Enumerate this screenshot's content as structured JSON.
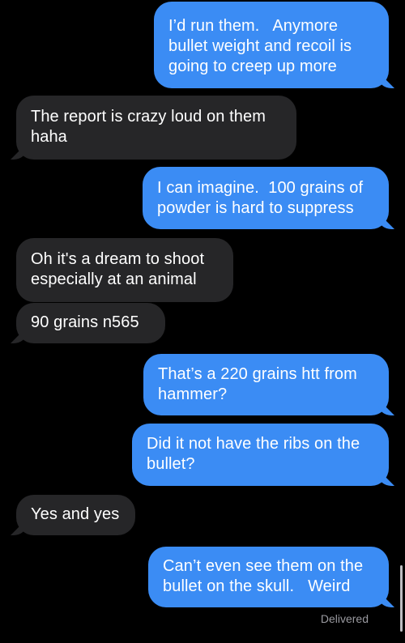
{
  "messages": [
    {
      "text": "I’d run them.   Anymore bullet weight and recoil is going to creep up more"
    },
    {
      "text": "The report is crazy loud on them haha"
    },
    {
      "text": "I can imagine.  100 grains of powder is hard to suppress"
    },
    {
      "text": "Oh it's a dream to shoot especially at an animal"
    },
    {
      "text": "90 grains n565"
    },
    {
      "text": "That’s a 220 grains htt from hammer?"
    },
    {
      "text": "Did it not have the ribs on the bullet?"
    },
    {
      "text": "Yes and yes"
    },
    {
      "text": "Can’t even see them on the bullet on the skull.   Weird"
    }
  ],
  "status": "Delivered",
  "colors": {
    "sent_bubble": "#3b8cf4",
    "received_bubble": "#262628",
    "background": "#000000",
    "status_text": "#9a9aa0"
  }
}
